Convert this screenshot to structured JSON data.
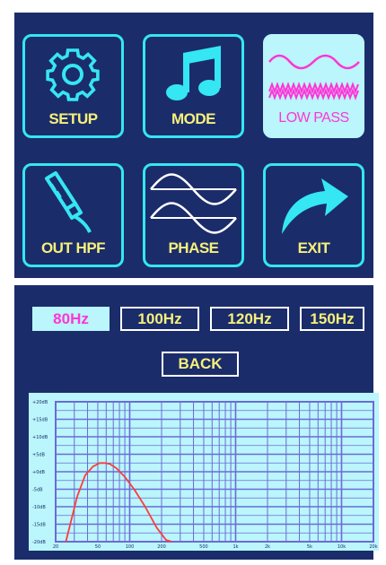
{
  "menu": {
    "tiles": [
      {
        "id": "setup",
        "label": "SETUP",
        "icon": "gear-icon",
        "active": false
      },
      {
        "id": "mode",
        "label": "MODE",
        "icon": "music-note-icon",
        "active": false
      },
      {
        "id": "low-pass",
        "label": "LOW PASS",
        "icon": "low-pass-wave-icon",
        "active": true
      },
      {
        "id": "out-hpf",
        "label": "OUT HPF",
        "icon": "rca-cable-icon",
        "active": false
      },
      {
        "id": "phase",
        "label": "PHASE",
        "icon": "phase-wave-icon",
        "active": false
      },
      {
        "id": "exit",
        "label": "EXIT",
        "icon": "curved-arrow-icon",
        "active": false
      }
    ]
  },
  "frequency_options": [
    {
      "label": "80Hz",
      "selected": true
    },
    {
      "label": "100Hz",
      "selected": false
    },
    {
      "label": "120Hz",
      "selected": false
    },
    {
      "label": "150Hz",
      "selected": false
    }
  ],
  "back_label": "BACK",
  "colors": {
    "panel_bg": "#1b2c6b",
    "tile_border": "#35e6f3",
    "active_bg": "#baf6fb",
    "label_yellow": "#f6f07a",
    "active_text": "#ff35d6",
    "grid": "#6d6ad6",
    "curve": "#ff3b3b"
  },
  "chart_data": {
    "type": "line",
    "x_scale": "log",
    "xlim": [
      20,
      20000
    ],
    "ylim": [
      -20,
      20
    ],
    "x_tick_labels": [
      "20",
      "50",
      "100",
      "200",
      "500",
      "1k",
      "2k",
      "5k",
      "10k",
      "20k"
    ],
    "x_tick_values": [
      20,
      50,
      100,
      200,
      500,
      1000,
      2000,
      5000,
      10000,
      20000
    ],
    "y_tick_labels": [
      "+20dB",
      "+15dB",
      "+10dB",
      "+5dB",
      "+0dB",
      "-5dB",
      "-10dB",
      "-15dB",
      "-20dB"
    ],
    "y_tick_values": [
      20,
      15,
      10,
      5,
      0,
      -5,
      -10,
      -15,
      -20
    ],
    "grid": true,
    "series": [
      {
        "x": [
          25,
          28,
          32,
          38,
          45,
          52,
          58,
          65,
          75,
          90,
          110,
          140,
          180,
          220,
          250
        ],
        "y": [
          -20,
          -14,
          -7,
          -1,
          1.5,
          2.5,
          2.5,
          2.2,
          1,
          -1.5,
          -5,
          -10,
          -16,
          -19.5,
          -20
        ]
      }
    ]
  }
}
